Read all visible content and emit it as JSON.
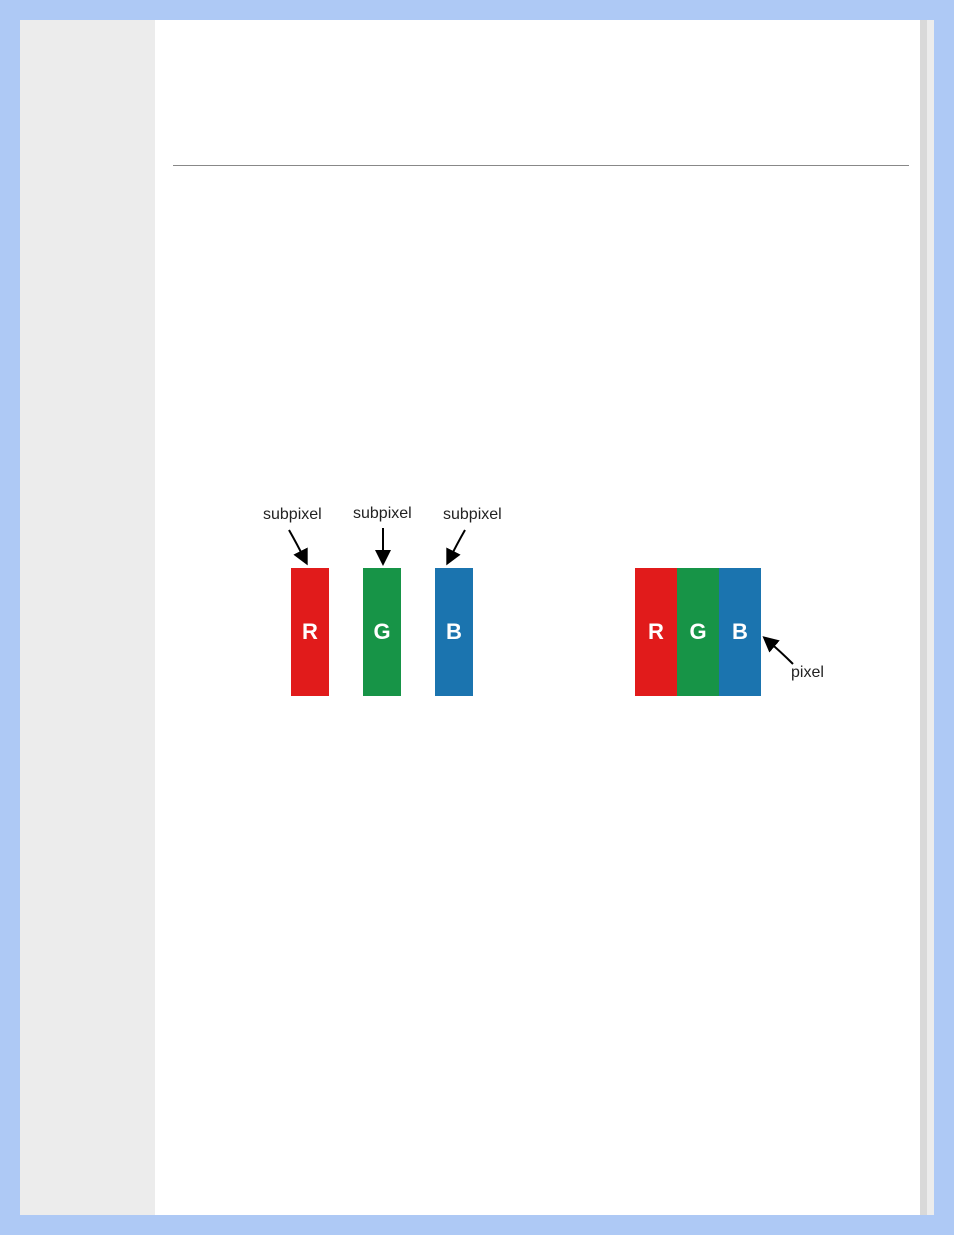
{
  "labels": {
    "subpixel_r": "subpixel",
    "subpixel_g": "subpixel",
    "subpixel_b": "subpixel",
    "pixel": "pixel"
  },
  "subpixels": {
    "r": {
      "letter": "R",
      "color": "#e11b1b"
    },
    "g": {
      "letter": "G",
      "color": "#179447"
    },
    "b": {
      "letter": "B",
      "color": "#1b74af"
    }
  },
  "combined": {
    "r": {
      "letter": "R",
      "color": "#e11b1b"
    },
    "g": {
      "letter": "G",
      "color": "#179447"
    },
    "b": {
      "letter": "B",
      "color": "#1b74af"
    }
  }
}
